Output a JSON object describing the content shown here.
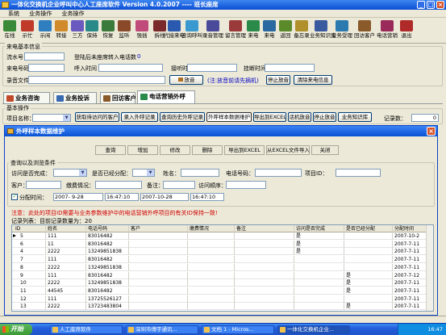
{
  "window": {
    "title": "一体化交换机企业呼叫中心人工座席软件 Version 4.0.2007 ---- 班长座席"
  },
  "menu": [
    "系统",
    "业务操作",
    "业务操作"
  ],
  "toolbar": [
    {
      "label": "在线",
      "icon": "online-icon",
      "color": "#3a8a3a"
    },
    {
      "label": "示忙",
      "icon": "busy-icon",
      "color": "#c03a2a"
    },
    {
      "label": "示闲",
      "icon": "idle-icon",
      "color": "#2f7ec0"
    },
    {
      "label": "转接",
      "icon": "transfer-icon",
      "color": "#d08a2a"
    },
    {
      "label": "三方",
      "icon": "three-way-icon",
      "color": "#6a5ac0"
    },
    {
      "label": "保持",
      "icon": "hold-icon",
      "color": "#2a8a8a"
    },
    {
      "label": "恢复",
      "icon": "resume-icon",
      "color": "#3a7a3a"
    },
    {
      "label": "监听",
      "icon": "monitor-icon",
      "color": "#8a4a2a"
    },
    {
      "label": "强插",
      "icon": "barge-in-icon",
      "color": "#c04a7a"
    },
    {
      "label": "拆线",
      "icon": "disconnect-icon",
      "color": "#7a2a2a"
    },
    {
      "label": "代接来电",
      "icon": "pickup-icon",
      "color": "#2a5ab0"
    },
    {
      "label": "咨询呼叫",
      "icon": "consult-icon",
      "color": "#3a9ad0"
    },
    {
      "label": "录音管理",
      "icon": "recording-icon",
      "color": "#4a4a9a"
    },
    {
      "label": "留言管理",
      "icon": "message-icon",
      "color": "#9a3a3a"
    },
    {
      "label": "来电",
      "icon": "incoming-call-icon",
      "color": "#2a8a4a"
    },
    {
      "label": "来电",
      "icon": "incoming-call-2-icon",
      "color": "#2a6aa0"
    },
    {
      "label": "返回",
      "icon": "return-icon",
      "color": "#5a8a2a"
    },
    {
      "label": "备忘录",
      "icon": "memo-icon",
      "color": "#b0902a"
    },
    {
      "label": "业务知识库",
      "icon": "knowledge-base-icon",
      "color": "#3a5aa0"
    },
    {
      "label": "业务受理",
      "icon": "business-accept-icon",
      "color": "#2a7ab0"
    },
    {
      "label": "回访客户",
      "icon": "callback-customer-icon",
      "color": "#8a5a2a"
    },
    {
      "label": "电话营销",
      "icon": "telemarketing-icon",
      "color": "#9a2a5a"
    },
    {
      "label": "退出",
      "icon": "exit-icon",
      "color": "#b02a2a"
    }
  ],
  "incoming_info": {
    "legend": "来电基本信息",
    "queue_label": "流水号",
    "transferred_label": "登陆后未座席转入电话数",
    "transferred_value": "0",
    "caller_label": "来电号码",
    "call_time_label": "呼入时间",
    "answer_time_label": "接听时间",
    "hangup_time_label": "挂断时间",
    "recording_label": "录音文件",
    "play_button": "放音",
    "note": "(注:放音前请先摘机)",
    "stop_button": "停止放音",
    "clear_button": "清除来电信息"
  },
  "tabs": [
    {
      "label": "业务咨询",
      "color": "#c04a2a"
    },
    {
      "label": "业务投诉",
      "color": "#3a6ab0"
    },
    {
      "label": "回访客户",
      "color": "#8a5a2a"
    },
    {
      "label": "电话营销外呼",
      "color": "#2a8a4a"
    }
  ],
  "basic_ops": {
    "legend": "基本操作",
    "project_label": "项目名称：",
    "buttons": [
      "获取待访问的客户",
      "录入外呼记录",
      "查询历史外呼记录",
      "外呼样本数据维护",
      "导出到EXCEL",
      "话机放音",
      "停止放音",
      "业务知识库"
    ],
    "count_label": "记录数：",
    "count_value": "0"
  },
  "dialog": {
    "title": "外呼样本数据维护",
    "buttons": [
      "查询",
      "增加",
      "修改",
      "删除",
      "导出到EXCEL",
      "从EXCEL文件导入",
      "关闭"
    ],
    "filter_legend": "查询以及浏览条件",
    "visited_label": "访问是否完成：",
    "assigned_label": "是否已经分配：",
    "name_label": "姓名：",
    "phone_label": "电话号码：",
    "project_id_label": "项目ID：",
    "tags_label": "客户：",
    "payment_label": "缴费情况：",
    "note_label": "备注：",
    "visit_order_label": "访问顺序：",
    "assign_time_label": "分配时间：",
    "date_from": "2007- 9-28",
    "time_from": "16:47:10",
    "date_to": "2007-10-28",
    "time_to": "16:47:10",
    "notice": "注意：此处的项目ID需要与业务参数维护中的电话营销外呼项目的有关ID保持一致!",
    "list_label": "记录列表：目前记录数量为：20",
    "columns": [
      "ID",
      "姓名",
      "电话号码",
      "客户",
      "缴费情况",
      "备注",
      "访问是否完成",
      "是否已经分配",
      "分配时间"
    ],
    "rows": [
      [
        "5",
        "111",
        "83016482",
        "",
        "",
        "",
        "是",
        "",
        "2007-10-2"
      ],
      [
        "6",
        "11",
        "83016482",
        "",
        "",
        "",
        "是",
        "",
        "2007-7-11"
      ],
      [
        "4",
        "2222",
        "13249851838",
        "",
        "",
        "",
        "是",
        "",
        "2007-7-11"
      ],
      [
        "7",
        "111",
        "83016482",
        "",
        "",
        "",
        "",
        "",
        "2007-7-11"
      ],
      [
        "8",
        "2222",
        "13249851838",
        "",
        "",
        "",
        "",
        "",
        "2007-7-11"
      ],
      [
        "9",
        "111",
        "83016482",
        "",
        "",
        "",
        "",
        "是",
        "2007-7-12"
      ],
      [
        "10",
        "2222",
        "13249851838",
        "",
        "",
        "",
        "",
        "是",
        "2007-7-11"
      ],
      [
        "11",
        "44545",
        "83016482",
        "",
        "",
        "",
        "",
        "是",
        "2007-7-11"
      ],
      [
        "12",
        "111",
        "13725526127",
        "",
        "",
        "",
        "",
        "",
        "2007-7-11"
      ],
      [
        "13",
        "2222",
        "13723483804",
        "",
        "",
        "",
        "",
        "是",
        "2007-7-11"
      ]
    ]
  },
  "taskbar": {
    "start": "开始",
    "tasks": [
      "人工座席软件",
      "深圳市傅宇通讯...",
      "文档 1 - Micros...",
      "一体化交换机企业..."
    ],
    "time": "16:47"
  }
}
